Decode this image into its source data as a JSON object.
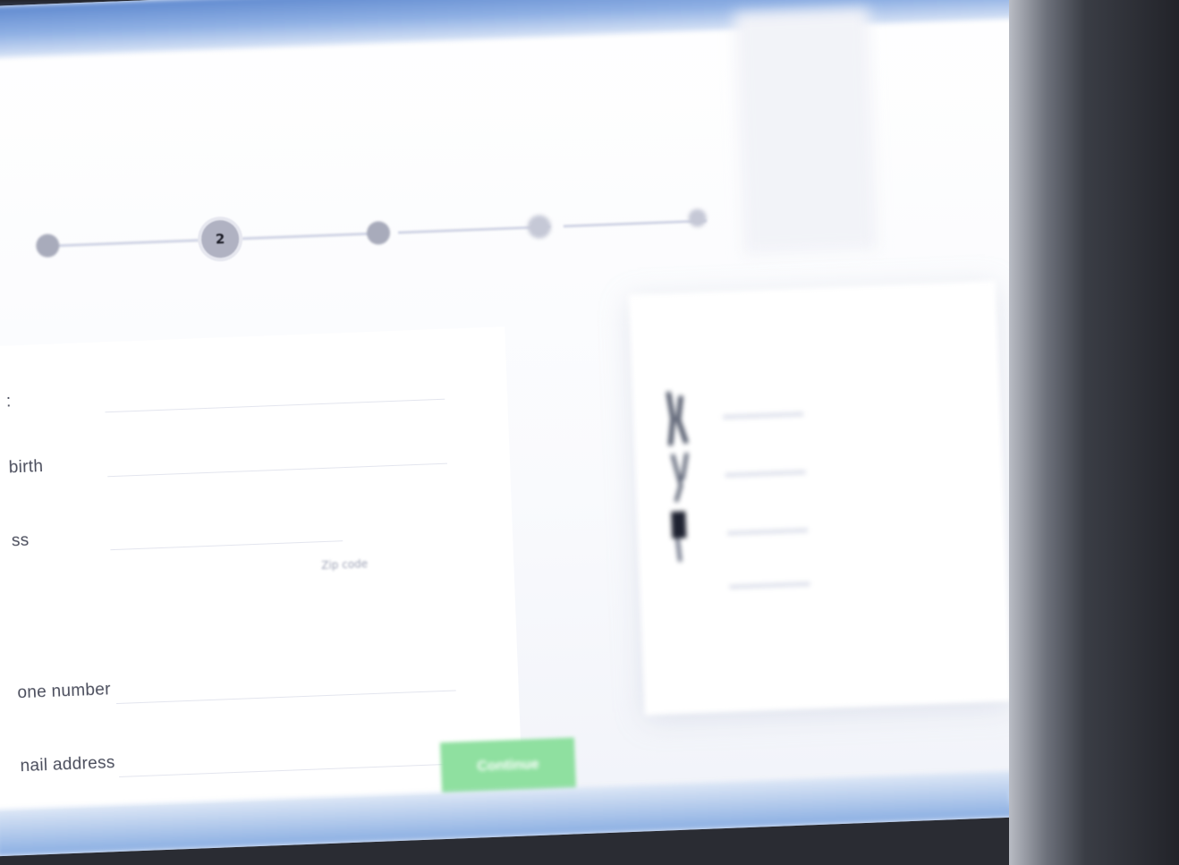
{
  "stepper": {
    "active_step": "2",
    "steps": [
      "",
      "2",
      "",
      "",
      ""
    ]
  },
  "form": {
    "fields": [
      {
        "label": ":",
        "name": "field-partial-top"
      },
      {
        "label": "birth",
        "name": "date-of-birth-label"
      },
      {
        "label": "ss",
        "name": "address-label"
      },
      {
        "label": "one number",
        "name": "phone-number-label"
      },
      {
        "label": "nail address",
        "name": "email-address-label"
      }
    ],
    "zip_placeholder": "Zip code",
    "continue_label": "Continue"
  },
  "summary": {
    "title": "",
    "items": [
      {
        "name": "",
        "price": ""
      },
      {
        "name": "",
        "price": ""
      },
      {
        "name": "",
        "price": ""
      },
      {
        "name": "",
        "price": ""
      }
    ],
    "subtotal_label": "",
    "total": ""
  },
  "colors": {
    "accent_green": "#8fe0a0",
    "step_active": "#b0b2c2",
    "step_dot": "#a8abbb",
    "titlebar_blue": "#5f89cf"
  }
}
